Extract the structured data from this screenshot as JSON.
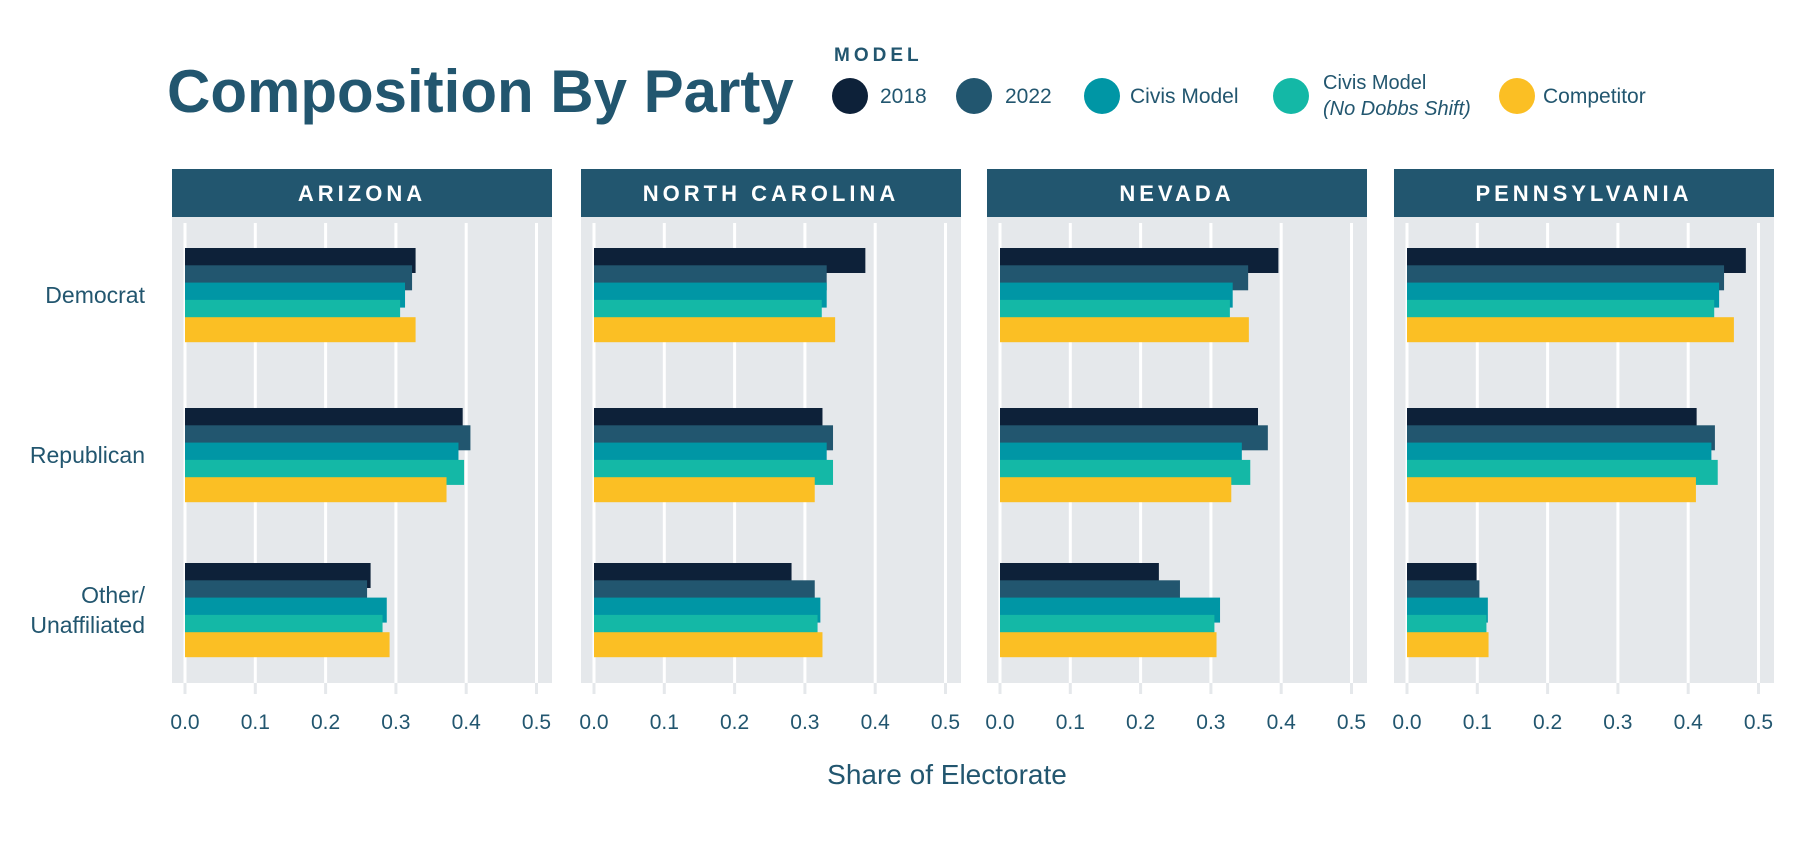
{
  "chart_data": {
    "type": "bar",
    "orientation": "horizontal",
    "title": "Composition By Party",
    "xlabel": "Share of Electorate",
    "ylabel": "",
    "xlim": [
      0,
      0.5
    ],
    "x_ticks": [
      "0.0",
      "0.1",
      "0.2",
      "0.3",
      "0.4",
      "0.5"
    ],
    "x_tick_values": [
      0,
      0.1,
      0.2,
      0.3,
      0.4,
      0.5
    ],
    "grid": true,
    "legend": {
      "title": "MODEL",
      "placement": "top",
      "entries": [
        {
          "name": "2018",
          "color": "#0d2139"
        },
        {
          "name": "2022",
          "color": "#22566f"
        },
        {
          "name": "Civis Model",
          "color": "#0096a5"
        },
        {
          "name": "Civis Model",
          "subtitle": "(No Dobbs Shift)",
          "color": "#14b8a6"
        },
        {
          "name": "Competitor",
          "color": "#fbbf24"
        }
      ]
    },
    "categories": [
      "Democrat",
      "Republican",
      "Other/Unaffiliated"
    ],
    "category_lines": [
      [
        "Democrat"
      ],
      [
        "Republican"
      ],
      [
        "Other/",
        "Unaffiliated"
      ]
    ],
    "panels": [
      {
        "state": "ARIZONA",
        "series": [
          {
            "name": "2018",
            "values": [
              0.328,
              0.395,
              0.264
            ]
          },
          {
            "name": "2022",
            "values": [
              0.323,
              0.406,
              0.259
            ]
          },
          {
            "name": "Civis Model",
            "values": [
              0.313,
              0.389,
              0.287
            ]
          },
          {
            "name": "Civis Model (No Dobbs Shift)",
            "values": [
              0.306,
              0.397,
              0.281
            ]
          },
          {
            "name": "Competitor",
            "values": [
              0.328,
              0.372,
              0.291
            ]
          }
        ]
      },
      {
        "state": "NORTH CAROLINA",
        "series": [
          {
            "name": "2018",
            "values": [
              0.386,
              0.325,
              0.281
            ]
          },
          {
            "name": "2022",
            "values": [
              0.331,
              0.34,
              0.314
            ]
          },
          {
            "name": "Civis Model",
            "values": [
              0.331,
              0.331,
              0.322
            ]
          },
          {
            "name": "Civis Model (No Dobbs Shift)",
            "values": [
              0.324,
              0.34,
              0.318
            ]
          },
          {
            "name": "Competitor",
            "values": [
              0.343,
              0.314,
              0.325
            ]
          }
        ]
      },
      {
        "state": "NEVADA",
        "series": [
          {
            "name": "2018",
            "values": [
              0.396,
              0.367,
              0.226
            ]
          },
          {
            "name": "2022",
            "values": [
              0.353,
              0.381,
              0.256
            ]
          },
          {
            "name": "Civis Model",
            "values": [
              0.331,
              0.344,
              0.313
            ]
          },
          {
            "name": "Civis Model (No Dobbs Shift)",
            "values": [
              0.327,
              0.356,
              0.305
            ]
          },
          {
            "name": "Competitor",
            "values": [
              0.354,
              0.329,
              0.308
            ]
          }
        ]
      },
      {
        "state": "PENNSYLVANIA",
        "series": [
          {
            "name": "2018",
            "values": [
              0.482,
              0.412,
              0.099
            ]
          },
          {
            "name": "2022",
            "values": [
              0.451,
              0.438,
              0.103
            ]
          },
          {
            "name": "Civis Model",
            "values": [
              0.444,
              0.433,
              0.115
            ]
          },
          {
            "name": "Civis Model (No Dobbs Shift)",
            "values": [
              0.437,
              0.442,
              0.113
            ]
          },
          {
            "name": "Competitor",
            "values": [
              0.465,
              0.411,
              0.116
            ]
          }
        ]
      }
    ]
  },
  "colors": {
    "header_bg": "#22566f",
    "panel_bg": "#e5e8eb",
    "gridline": "#ffffff",
    "text": "#22566f"
  }
}
